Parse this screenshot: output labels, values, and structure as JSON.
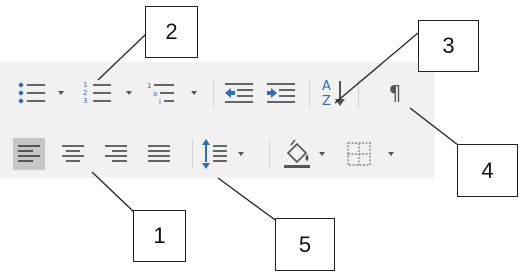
{
  "toolbar": {
    "row1": [
      {
        "name": "bullets-button",
        "icon": "bullets-icon",
        "dropdown": true
      },
      {
        "name": "numbering-button",
        "icon": "numbering-icon",
        "dropdown": true
      },
      {
        "name": "multilevel-list-button",
        "icon": "multilevel-list-icon",
        "dropdown": true
      },
      {
        "name": "decrease-indent-button",
        "icon": "decrease-indent-icon",
        "dropdown": false
      },
      {
        "name": "increase-indent-button",
        "icon": "increase-indent-icon",
        "dropdown": false
      },
      {
        "name": "sort-button",
        "icon": "sort-az-icon",
        "dropdown": false
      },
      {
        "name": "show-hide-marks-button",
        "icon": "pilcrow-icon",
        "dropdown": false
      }
    ],
    "row2": [
      {
        "name": "align-left-button",
        "icon": "align-left-icon",
        "dropdown": false,
        "selected": true
      },
      {
        "name": "center-button",
        "icon": "align-center-icon",
        "dropdown": false
      },
      {
        "name": "align-right-button",
        "icon": "align-right-icon",
        "dropdown": false
      },
      {
        "name": "justify-button",
        "icon": "justify-icon",
        "dropdown": false
      },
      {
        "name": "line-spacing-button",
        "icon": "line-spacing-icon",
        "dropdown": true
      },
      {
        "name": "shading-button",
        "icon": "paint-bucket-icon",
        "dropdown": true
      },
      {
        "name": "borders-button",
        "icon": "borders-icon",
        "dropdown": true
      }
    ],
    "pilcrow_glyph": "¶",
    "sort_glyphs": {
      "top": "A",
      "bottom": "Z"
    },
    "colors": {
      "icon_gray": "#666666",
      "icon_blue": "#2f6db5",
      "selected_bg": "#c6c6c6",
      "toolbar_bg": "#f1f1f1"
    }
  },
  "callouts": {
    "c1": "1",
    "c2": "2",
    "c3": "3",
    "c4": "4",
    "c5": "5"
  }
}
